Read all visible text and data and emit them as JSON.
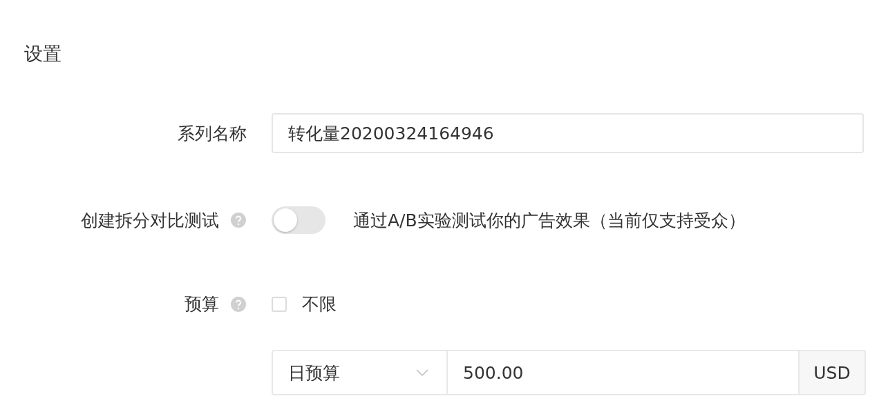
{
  "section_title": "设置",
  "campaign_name": {
    "label": "系列名称",
    "value": "转化量20200324164946"
  },
  "split_test": {
    "label": "创建拆分对比测试",
    "help": true,
    "on": false,
    "description": "通过A/B实验测试你的广告效果（当前仅支持受众）"
  },
  "budget": {
    "label": "预算",
    "help": true,
    "unlimited": {
      "label": "不限",
      "checked": false
    },
    "type": "日预算",
    "amount": "500.00",
    "currency": "USD"
  }
}
